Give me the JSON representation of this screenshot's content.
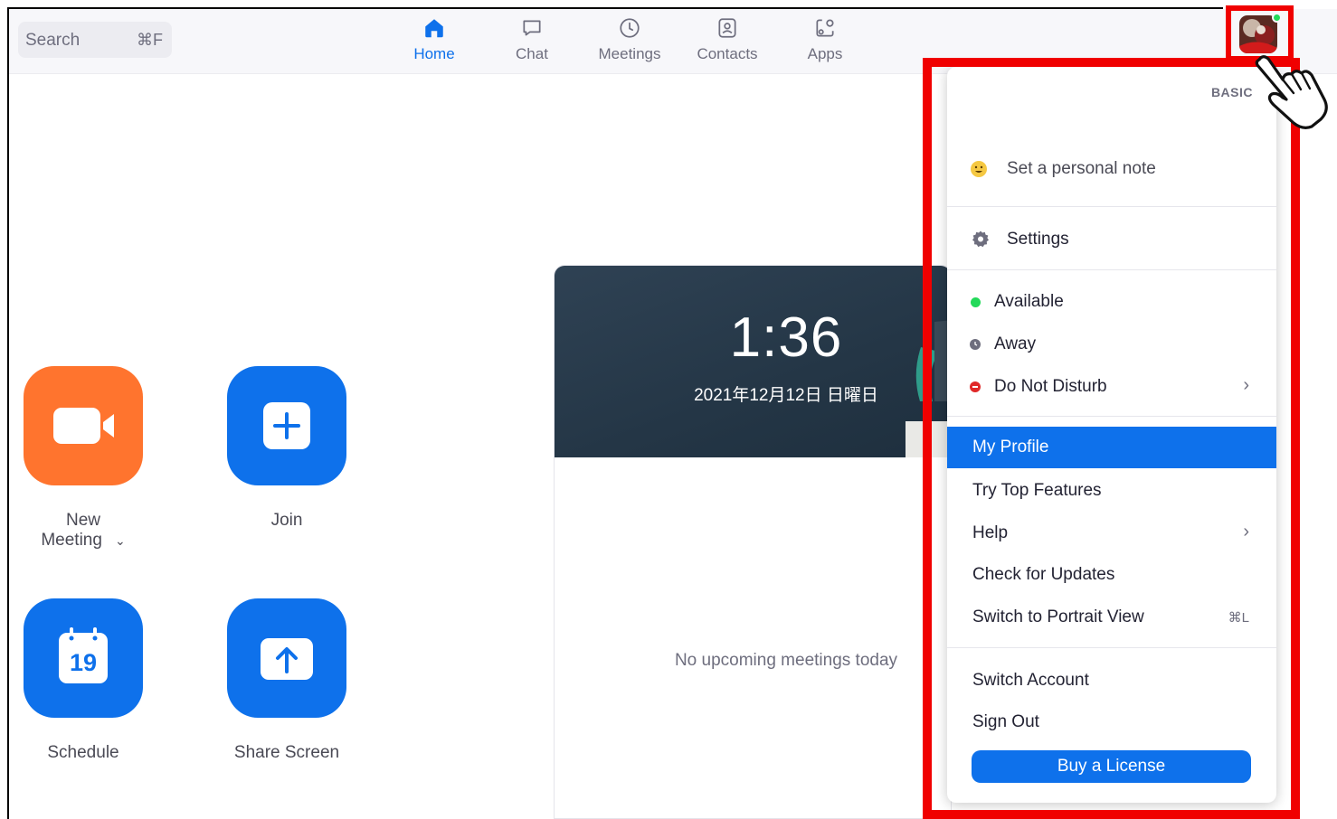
{
  "search": {
    "placeholder": "Search",
    "shortcut": "⌘F"
  },
  "nav": {
    "tabs": [
      {
        "label": "Home",
        "icon": "home-icon",
        "active": true
      },
      {
        "label": "Chat",
        "icon": "chat-icon",
        "active": false
      },
      {
        "label": "Meetings",
        "icon": "clock-icon",
        "active": false
      },
      {
        "label": "Contacts",
        "icon": "contacts-icon",
        "active": false
      },
      {
        "label": "Apps",
        "icon": "apps-icon",
        "active": false
      }
    ]
  },
  "profile": {
    "status_color": "#23d959"
  },
  "actions": {
    "new_meeting": "New Meeting",
    "join": "Join",
    "schedule": "Schedule",
    "schedule_day": "19",
    "share_screen": "Share Screen"
  },
  "calendar": {
    "time": "1:36",
    "date": "2021年12月12日 日曜日",
    "empty": "No upcoming meetings today"
  },
  "menu": {
    "plan": "BASIC",
    "personal_note": "Set a personal note",
    "settings": "Settings",
    "status": {
      "available": "Available",
      "away": "Away",
      "dnd": "Do Not Disturb"
    },
    "my_profile": "My Profile",
    "try_features": "Try Top Features",
    "help": "Help",
    "check_updates": "Check for Updates",
    "portrait_view": "Switch to Portrait View",
    "portrait_shortcut": "⌘L",
    "switch_account": "Switch Account",
    "sign_out": "Sign Out",
    "buy_license": "Buy a License"
  },
  "colors": {
    "accent": "#0e71eb",
    "orange": "#ff742e",
    "highlight": "#f00000",
    "available": "#23d959",
    "away": "#6e6e7e",
    "dnd": "#e02828"
  }
}
